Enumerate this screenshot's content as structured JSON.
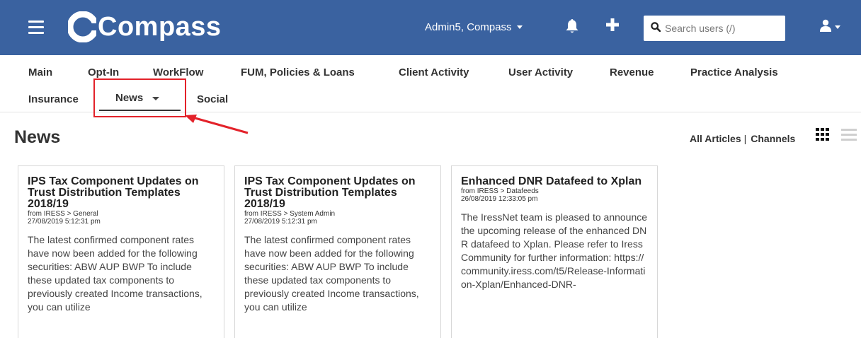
{
  "app": {
    "title": "Compass",
    "brand_color": "#3a62a0"
  },
  "header": {
    "user_menu_label": "Admin5, Compass",
    "search_placeholder": "Search users (/)",
    "icons": [
      "menu-icon",
      "bell-icon",
      "plus-icon",
      "search-icon",
      "user-icon"
    ]
  },
  "tabs": {
    "row1": [
      "Main",
      "Opt-In",
      "WorkFlow",
      "FUM, Policies & Loans",
      "Client Activity",
      "User Activity",
      "Revenue",
      "Practice Analysis"
    ],
    "row2": [
      "Insurance",
      "News",
      "Social"
    ],
    "active": "News",
    "highlight_color": "#e3222a"
  },
  "page": {
    "title": "News",
    "all_articles_label": "All Articles",
    "separator": "|",
    "channels_label": "Channels"
  },
  "cards": [
    {
      "title": "IPS Tax Component Updates on Trust Distribution Templates 2018/19",
      "source": "from IRESS > General",
      "date": "27/08/2019 5:12:31 pm",
      "body": "The latest confirmed component rates have now been added for the following securities: ABW AUP BWP To include these updated tax components to previously created Income transactions, you can utilize"
    },
    {
      "title": "IPS Tax Component Updates on Trust Distribution Templates 2018/19",
      "source": "from IRESS > System Admin",
      "date": "27/08/2019 5:12:31 pm",
      "body": "The latest confirmed component rates have now been added for the following securities: ABW AUP BWP To include these updated tax components to previously created Income transactions, you can utilize"
    },
    {
      "title": "Enhanced DNR Datafeed to Xplan",
      "source": "from IRESS > Datafeeds",
      "date": "26/08/2019 12:33:05 pm",
      "body": "The IressNet team is pleased to announce the upcoming release of the enhanced DNR datafeed to Xplan. Please refer to Iress Community for further information: https://community.iress.com/t5/Release-Information-Xplan/Enhanced-DNR-"
    }
  ]
}
